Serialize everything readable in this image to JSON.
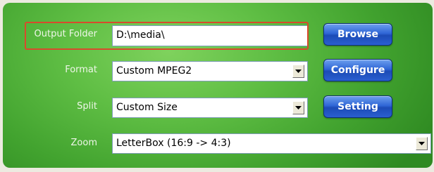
{
  "form": {
    "output_folder": {
      "label": "Output Folder",
      "value": "D:\\media\\"
    },
    "format": {
      "label": "Format",
      "value": "Custom MPEG2"
    },
    "split": {
      "label": "Split",
      "value": "Custom Size"
    },
    "zoom": {
      "label": "Zoom",
      "value": "LetterBox (16:9 -> 4:3)"
    }
  },
  "buttons": {
    "browse": "Browse",
    "configure": "Configure",
    "setting": "Setting"
  },
  "colors": {
    "panel_green": "#5fbe44",
    "button_blue": "#2f66d6",
    "highlight_red": "#d84a2c"
  },
  "icons": {
    "dropdown": "chevron-down-icon"
  }
}
